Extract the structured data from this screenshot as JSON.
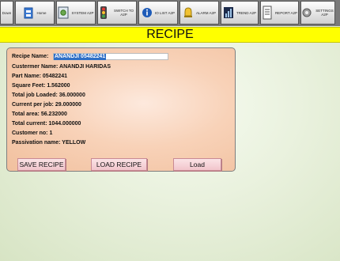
{
  "toolbar": {
    "buttons": [
      {
        "label": "Down",
        "icon": "arrow-down-icon"
      },
      {
        "label": "Home",
        "icon": "home-icon"
      },
      {
        "label": "SYSTEM A2P",
        "icon": "settings-panel-icon"
      },
      {
        "label": "SWITCH TO A2P",
        "icon": "traffic-light-icon"
      },
      {
        "label": "IO LIST A2P",
        "icon": "info-icon"
      },
      {
        "label": "ALARM A2P",
        "icon": "alarm-bell-icon"
      },
      {
        "label": "TREND A2P",
        "icon": "trend-chart-icon"
      },
      {
        "label": "REPORT A2P",
        "icon": "report-icon"
      },
      {
        "label": "SETTINGS A2P",
        "icon": "settings-icon"
      }
    ]
  },
  "page": {
    "title": "RECIPE"
  },
  "recipe": {
    "name_label": "Recipe Name:",
    "name_value": "ANANDJI 05482241",
    "fields": [
      "Custermer Name: ANANDJI HARIDAS",
      "Part Name: 05482241",
      "Square Feet: 1.562000",
      "Total job Loaded: 36.000000",
      "Current per job: 29.000000",
      "Total area: 56.232000",
      "Total current: 1044.000000",
      "Customer no: 1",
      "Passivation name: YELLOW"
    ]
  },
  "actions": {
    "save": "SAVE RECIPE",
    "load_recipe": "LOAD RECIPE",
    "load": "Load"
  },
  "colors": {
    "title_bar": "#ffff00",
    "selection": "#2f6fc6",
    "panel": "#f8d2b8"
  }
}
